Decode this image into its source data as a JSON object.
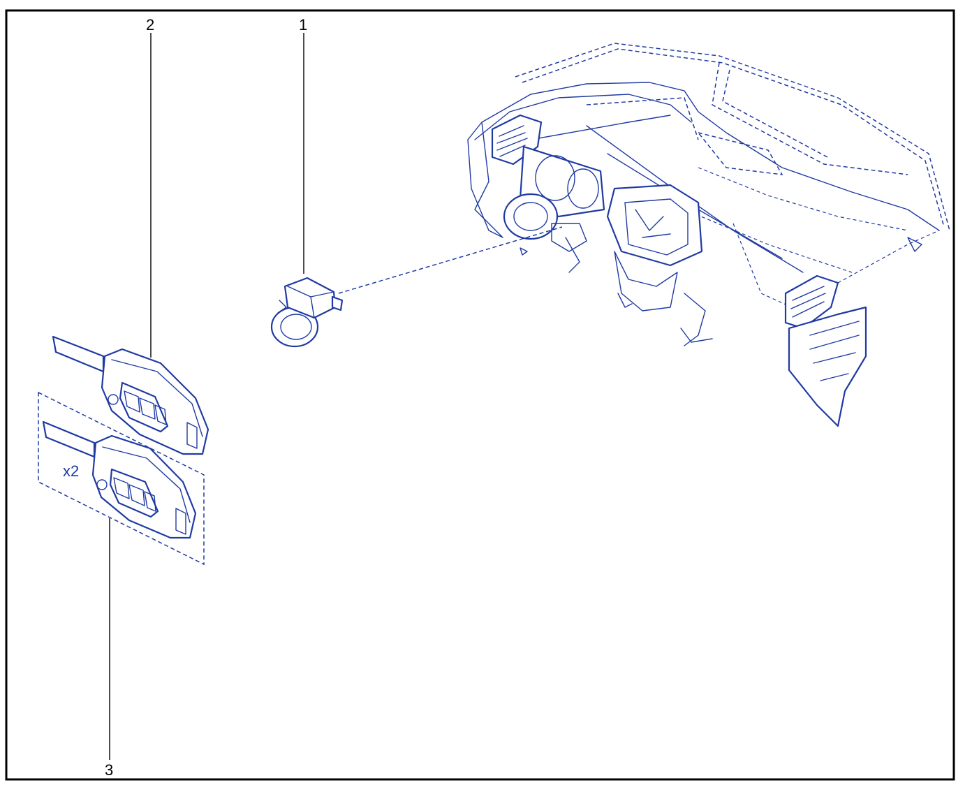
{
  "colors": {
    "line": "#1f3aa3",
    "frame": "#000000",
    "text": "#000000"
  },
  "callouts": [
    {
      "id": "1",
      "label": "1"
    },
    {
      "id": "2",
      "label": "2"
    },
    {
      "id": "3",
      "label": "3"
    }
  ],
  "quantity_label": "x2"
}
